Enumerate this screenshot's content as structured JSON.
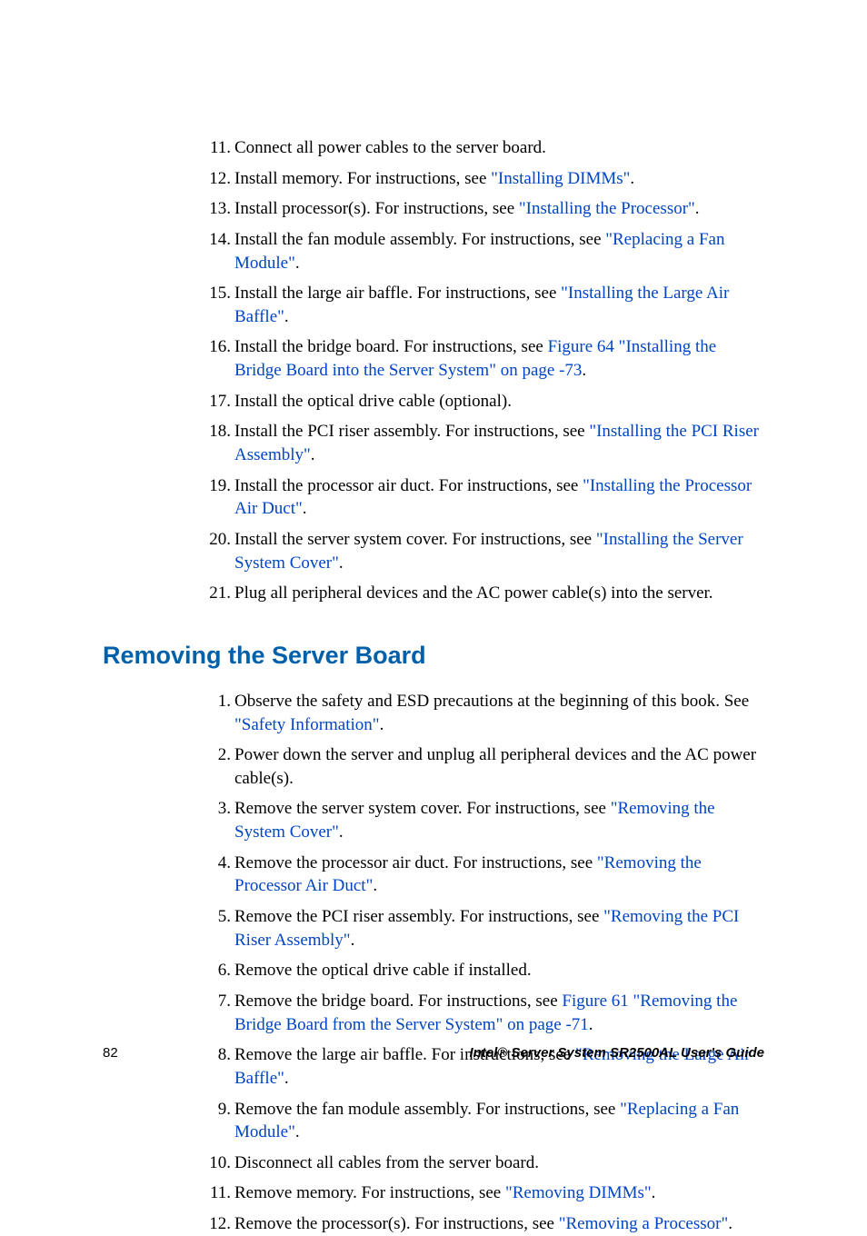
{
  "section_title": "Removing the Server Board",
  "footer": {
    "page_number": "82",
    "doc_title": "Intel® Server System SR2500AL User's Guide"
  },
  "list_a": [
    {
      "n": "11.",
      "pre": "Connect all power cables to the server board.",
      "link": "",
      "post": ""
    },
    {
      "n": "12.",
      "pre": "Install memory. For instructions, see ",
      "link": "\"Installing DIMMs\"",
      "post": "."
    },
    {
      "n": "13.",
      "pre": "Install processor(s). For instructions, see ",
      "link": "\"Installing the Processor\"",
      "post": "."
    },
    {
      "n": "14.",
      "pre": "Install the fan module assembly. For instructions, see ",
      "link": "\"Replacing a Fan Module\"",
      "post": "."
    },
    {
      "n": "15.",
      "pre": "Install the large air baffle. For instructions, see ",
      "link": "\"Installing the Large Air Baffle\"",
      "post": "."
    },
    {
      "n": "16.",
      "pre": "Install the bridge board. For instructions, see ",
      "link": "Figure 64 \"Installing the Bridge Board into the Server System\" on page -73",
      "post": "."
    },
    {
      "n": "17.",
      "pre": "Install the optical drive cable (optional).",
      "link": "",
      "post": ""
    },
    {
      "n": "18.",
      "pre": "Install the PCI riser assembly. For instructions, see ",
      "link": "\"Installing the PCI Riser Assembly\"",
      "post": "."
    },
    {
      "n": "19.",
      "pre": "Install the processor air duct. For instructions, see ",
      "link": "\"Installing the Processor Air Duct\"",
      "post": "."
    },
    {
      "n": "20.",
      "pre": "Install the server system cover. For instructions, see ",
      "link": "\"Installing the Server System Cover\"",
      "post": "."
    },
    {
      "n": "21.",
      "pre": "Plug all peripheral devices and the AC power cable(s) into the server.",
      "link": "",
      "post": ""
    }
  ],
  "list_b": [
    {
      "n": "1.",
      "pre": "Observe the safety and ESD precautions at the beginning of this book. See ",
      "link": "\"Safety Information\"",
      "post": "."
    },
    {
      "n": "2.",
      "pre": "Power down the server and unplug all peripheral devices and the AC power cable(s).",
      "link": "",
      "post": ""
    },
    {
      "n": "3.",
      "pre": "Remove the server system cover. For instructions, see ",
      "link": "\"Removing the System Cover\"",
      "post": "."
    },
    {
      "n": "4.",
      "pre": "Remove the processor air duct. For instructions, see ",
      "link": "\"Removing the Processor Air Duct\"",
      "post": "."
    },
    {
      "n": "5.",
      "pre": "Remove the PCI riser assembly. For instructions, see ",
      "link": "\"Removing the PCI Riser Assembly\"",
      "post": "."
    },
    {
      "n": "6.",
      "pre": "Remove the optical drive cable if installed.",
      "link": "",
      "post": ""
    },
    {
      "n": "7.",
      "pre": "Remove the bridge board. For instructions, see ",
      "link": "Figure 61 \"Removing the Bridge Board from the Server System\" on page -71",
      "post": "."
    },
    {
      "n": "8.",
      "pre": "Remove the large air baffle. For instructions, see ",
      "link": "\"Removing the Large Air Baffle\"",
      "post": "."
    },
    {
      "n": "9.",
      "pre": "Remove the fan module assembly. For instructions, see ",
      "link": "\"Replacing a Fan Module\"",
      "post": "."
    },
    {
      "n": "10.",
      "pre": "Disconnect all cables from the server board.",
      "link": "",
      "post": ""
    },
    {
      "n": "11.",
      "pre": "Remove memory. For instructions, see ",
      "link": "\"Removing DIMMs\"",
      "post": "."
    },
    {
      "n": "12.",
      "pre": "Remove the processor(s). For instructions, see ",
      "link": "\"Removing a Processor\"",
      "post": "."
    }
  ]
}
